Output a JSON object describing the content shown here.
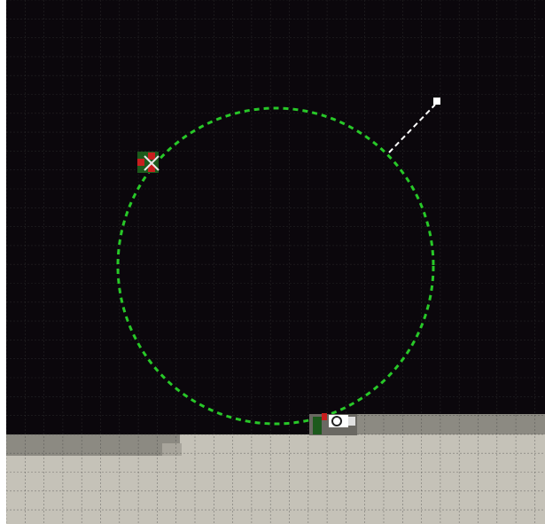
{
  "editor": {
    "background_color": "#0b070c",
    "grid_color": "#3a3a3a",
    "floor_color": "#c5c2b8",
    "floor_shadow_color": "#8c8a82",
    "grid_visible": true
  },
  "selection": {
    "shape": "circle",
    "outline_color": "#28c828",
    "outline_style": "dashed"
  },
  "handle": {
    "color": "#ffffff",
    "line_style": "dashed"
  },
  "icons": [
    "control-point-icon",
    "pivot-marker-icon"
  ]
}
